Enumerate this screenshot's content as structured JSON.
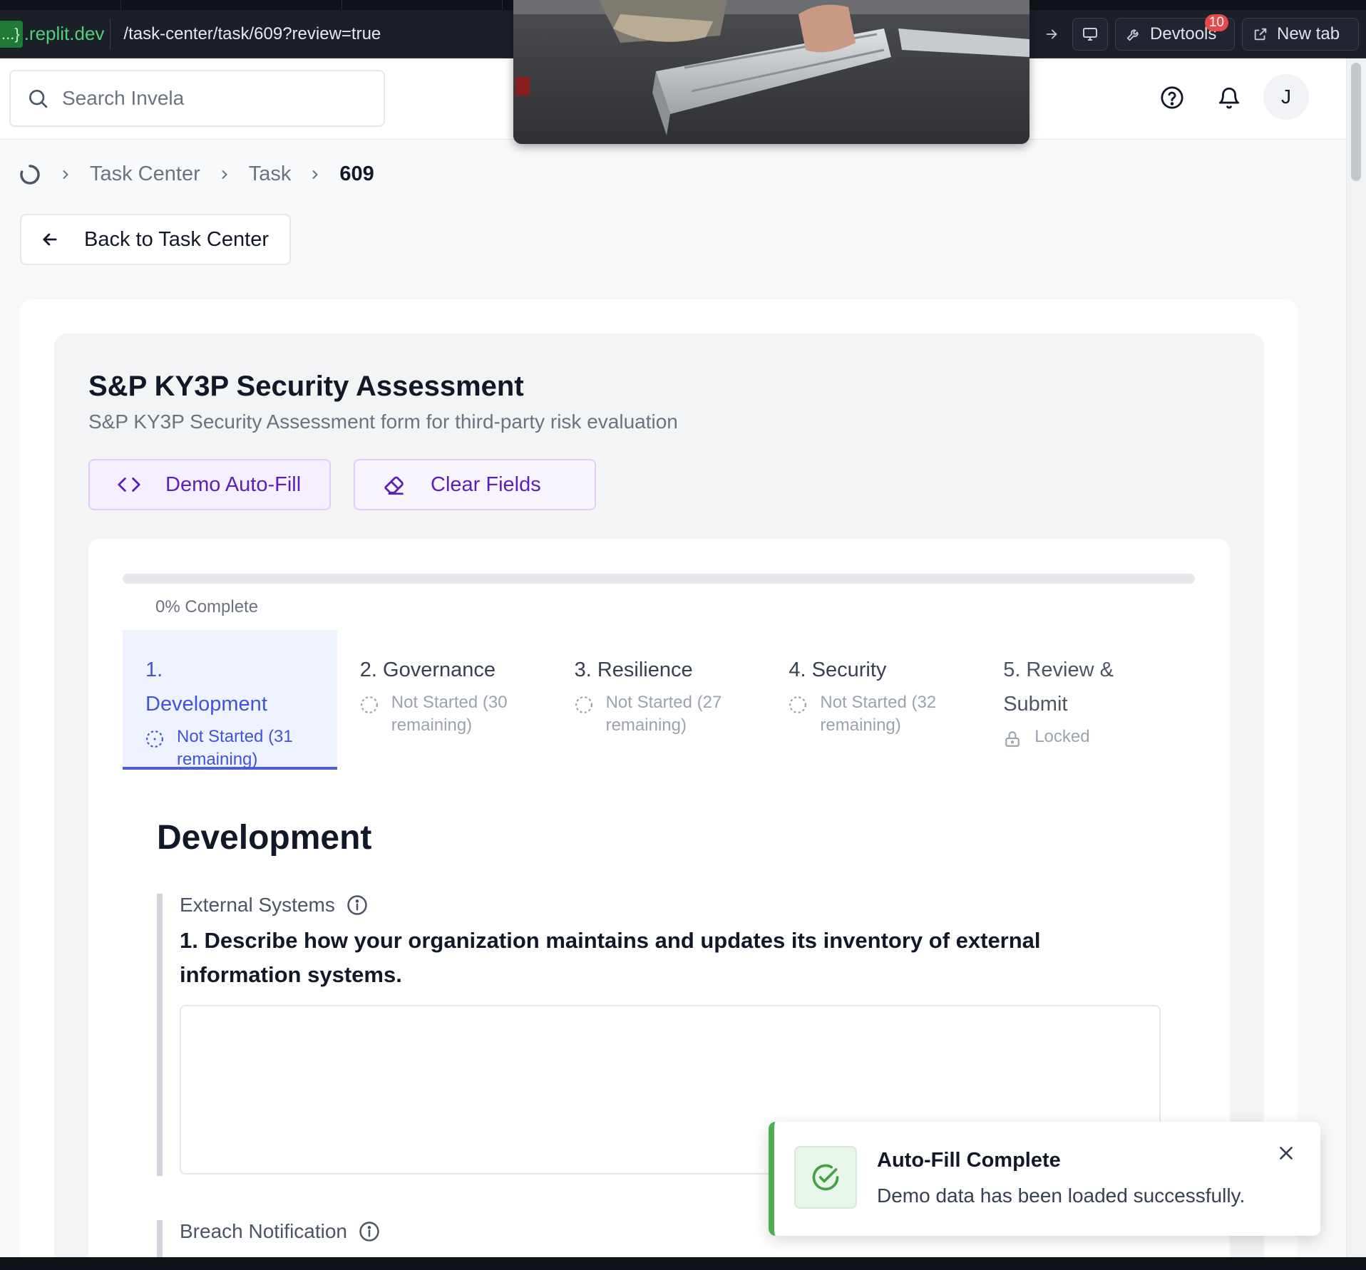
{
  "browser": {
    "host_tag": "...}",
    "host_domain": ".replit.dev",
    "url_path": "/task-center/task/609?review=true",
    "devtools_label": "Devtools",
    "devtools_badge": "10",
    "new_tab_label": "New tab"
  },
  "header": {
    "search_placeholder": "Search Invela",
    "avatar_initial": "J"
  },
  "breadcrumb": {
    "items": [
      "Task Center",
      "Task"
    ],
    "current": "609"
  },
  "back_button_label": "Back to Task Center",
  "form": {
    "title": "S&P KY3P Security Assessment",
    "subtitle": "S&P KY3P Security Assessment form for third-party risk evaluation",
    "demo_autofill_label": "Demo Auto-Fill",
    "clear_fields_label": "Clear Fields",
    "progress_percent": 0,
    "progress_label": "0% Complete"
  },
  "steps": [
    {
      "title": "1. Development",
      "status": "Not Started (31 remaining)",
      "state": "active"
    },
    {
      "title": "2. Governance",
      "status": "Not Started (30 remaining)",
      "state": "not-started"
    },
    {
      "title": "3. Resilience",
      "status": "Not Started (27 remaining)",
      "state": "not-started"
    },
    {
      "title": "4. Security",
      "status": "Not Started (32 remaining)",
      "state": "not-started"
    },
    {
      "title": "5. Review & Submit",
      "status": "Locked",
      "state": "locked"
    }
  ],
  "section": {
    "title": "Development",
    "questions": [
      {
        "label": "External Systems",
        "text": "1. Describe how your organization maintains and updates its inventory of external information systems.",
        "answer": ""
      },
      {
        "label": "Breach Notification"
      }
    ]
  },
  "toast": {
    "title": "Auto-Fill Complete",
    "message": "Demo data has been loaded successfully."
  },
  "colors": {
    "accent": "#4154d6",
    "purple": "#5b21b6",
    "success": "#4caf50"
  }
}
